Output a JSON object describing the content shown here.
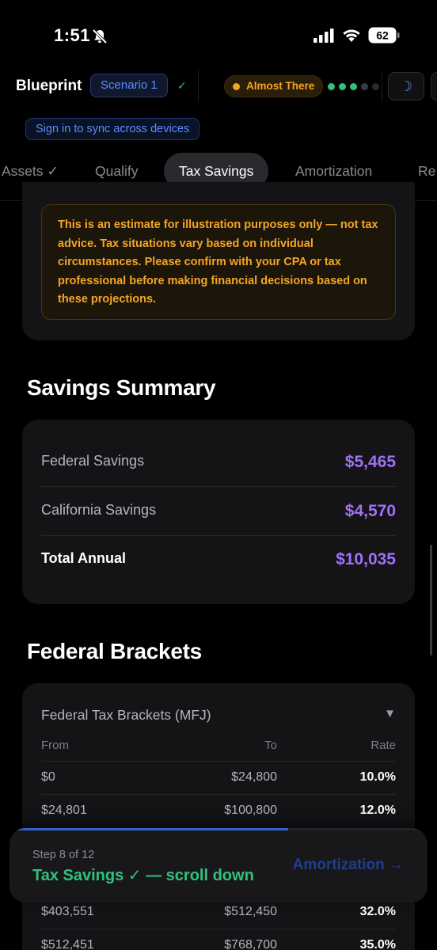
{
  "status_bar": {
    "time": "1:51",
    "battery": "62",
    "mute_icon": "bell-slash-icon",
    "signal_icon": "cellular-signal-icon",
    "wifi_icon": "wifi-icon"
  },
  "header": {
    "brand": "Blueprint",
    "scenario": "Scenario 1",
    "saved_mark": "✓",
    "status": "Almost There",
    "status_color": "#f5a623",
    "progress_dots": [
      "#2ec27e",
      "#2ec27e",
      "#2ec27e",
      "#3a3a3e",
      "#2a2a2e"
    ],
    "theme_icon": "☽",
    "sync_label": "Sign in to sync across devices"
  },
  "tabs": [
    {
      "label": "Assets ✓"
    },
    {
      "label": "Qualify"
    },
    {
      "label": "Tax Savings",
      "active": true
    },
    {
      "label": "Amortization"
    },
    {
      "label": "Re"
    }
  ],
  "disclaimer": "This is an estimate for illustration purposes only — not tax advice. Tax situations vary based on individual circumstances. Please confirm with your CPA or tax professional before making financial decisions based on these projections.",
  "savings_summary": {
    "title": "Savings Summary",
    "rows": [
      {
        "label": "Federal Savings",
        "value": "$5,465"
      },
      {
        "label": "California Savings",
        "value": "$4,570"
      },
      {
        "label": "Total Annual",
        "value": "$10,035"
      }
    ],
    "value_color": "#a070f5"
  },
  "federal_brackets": {
    "section_title": "Federal Brackets",
    "table_title": "Federal Tax Brackets (MFJ)",
    "caret": "▼",
    "columns": [
      "From",
      "To",
      "Rate"
    ],
    "rows": [
      {
        "from": "$0",
        "to": "$24,800",
        "rate": "10.0%"
      },
      {
        "from": "$24,801",
        "to": "$100,800",
        "rate": "12.0%"
      },
      {
        "from": "$403,551",
        "to": "$512,450",
        "rate": "32.0%"
      },
      {
        "from": "$512,451",
        "to": "$768,700",
        "rate": "35.0%"
      }
    ]
  },
  "step": {
    "count": "Step 8 of 12",
    "label": "Tax Savings ✓ — scroll down",
    "next_label": "Amortization →",
    "progress": 0.667
  }
}
